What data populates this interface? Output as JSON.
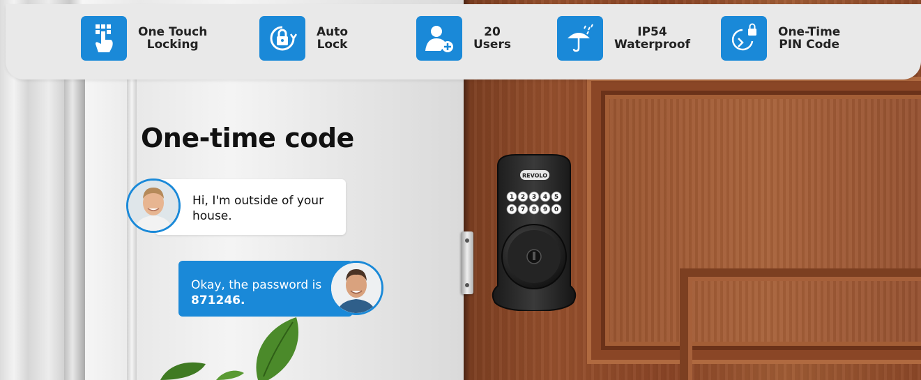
{
  "features": [
    {
      "icon": "keypad-touch-icon",
      "line1": "One Touch",
      "line2": "Locking"
    },
    {
      "icon": "auto-lock-icon",
      "line1": "Auto",
      "line2": "Lock"
    },
    {
      "icon": "users-add-icon",
      "line1": "20",
      "line2": "Users"
    },
    {
      "icon": "umbrella-rain-icon",
      "line1": "IP54",
      "line2": "Waterproof"
    },
    {
      "icon": "clock-lock-icon",
      "line1": "One-Time",
      "line2": "PIN Code"
    }
  ],
  "heading": "One-time code",
  "chat": {
    "message1": "Hi, I'm outside of your house.",
    "message2_prefix": "Okay, the password is ",
    "message2_code": "871246."
  },
  "lock": {
    "brand": "REVOLO",
    "keys_row1": [
      "1",
      "2",
      "3",
      "4",
      "5"
    ],
    "keys_row2": [
      "6",
      "7",
      "8",
      "9",
      "0"
    ]
  },
  "colors": {
    "accent": "#1a89d8",
    "header_bg": "#e9e9e9",
    "door": "#96502d"
  }
}
